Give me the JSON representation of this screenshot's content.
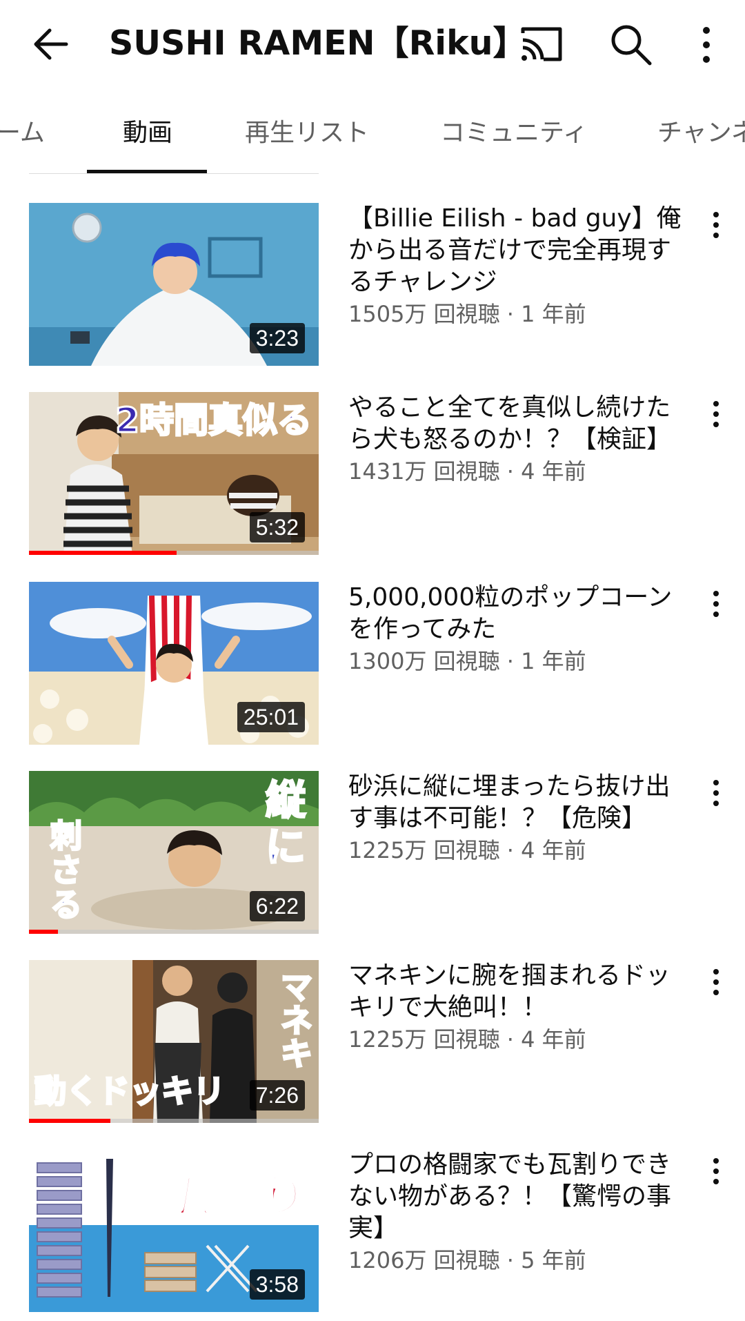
{
  "header": {
    "title": "SUSHI RAMEN【Riku】",
    "icons": [
      "back-arrow-icon",
      "cast-icon",
      "search-icon",
      "more-vert-icon"
    ]
  },
  "tabs": [
    {
      "label": "ホーム",
      "visible_text": "ーム",
      "active": false
    },
    {
      "label": "動画",
      "active": true
    },
    {
      "label": "再生リスト",
      "active": false
    },
    {
      "label": "コミュニティ",
      "active": false
    },
    {
      "label": "チャンネル",
      "visible_text": "チャンネ",
      "active": false
    }
  ],
  "videos": [
    {
      "title": "【Billie Eilish - bad guy】俺から出る音だけで完全再現するチャレンジ",
      "title_lines": [
        "【Billie Eilish - bad guy】俺",
        "から出る音だけで完全再現す",
        "るチャレンジ"
      ],
      "meta": "1505万 回視聴 · 1 年前",
      "duration": "3:23",
      "watched": 0
    },
    {
      "title": "やること全てを真似し続けたら犬も怒るのか！？【検証】",
      "title_lines": [
        "やること全てを真似し続けた",
        "ら犬も怒るのか！？【検証】"
      ],
      "meta": "1431万 回視聴 · 4 年前",
      "duration": "5:32",
      "watched": 0.51,
      "thumb_text": "2時間真似る"
    },
    {
      "title": "5,000,000粒のポップコーンを作ってみた",
      "title_lines": [
        "5,000,000粒のポップコーン",
        "を作ってみた"
      ],
      "meta": "1300万 回視聴 · 1 年前",
      "duration": "25:01",
      "watched": 0
    },
    {
      "title": "砂浜に縦に埋まったら抜け出す事は不可能！？【危険】",
      "title_lines": [
        "砂浜に縦に埋まったら抜け出",
        "す事は不可能！？【危険】"
      ],
      "meta": "1225万 回視聴 · 4 年前",
      "duration": "6:22",
      "watched": 0.1,
      "thumb_text": [
        "刺さる",
        "縦に"
      ]
    },
    {
      "title": "マネキンに腕を掴まれるドッキリで大絶叫！！",
      "title_lines": [
        "マネキンに腕を掴まれるドッ",
        "キリで大絶叫！！"
      ],
      "meta": "1225万 回視聴 · 4 年前",
      "duration": "7:26",
      "watched": 0.28,
      "thumb_text": [
        "動くドッキリ",
        "マネキン"
      ]
    },
    {
      "title": "プロの格闘家でも瓦割りできない物がある？！【驚愕の事実】",
      "title_lines": [
        "プロの格闘家でも瓦割りでき",
        "ない物がある？！【驚愕の事",
        "実】"
      ],
      "meta": "1206万 回視聴 · 5 年前",
      "duration": "3:58",
      "watched": 0,
      "thumb_text": "瓦割り"
    }
  ],
  "colors": {
    "progress": "#ff0000",
    "text": "#0f0f0f",
    "secondary": "#606060"
  }
}
